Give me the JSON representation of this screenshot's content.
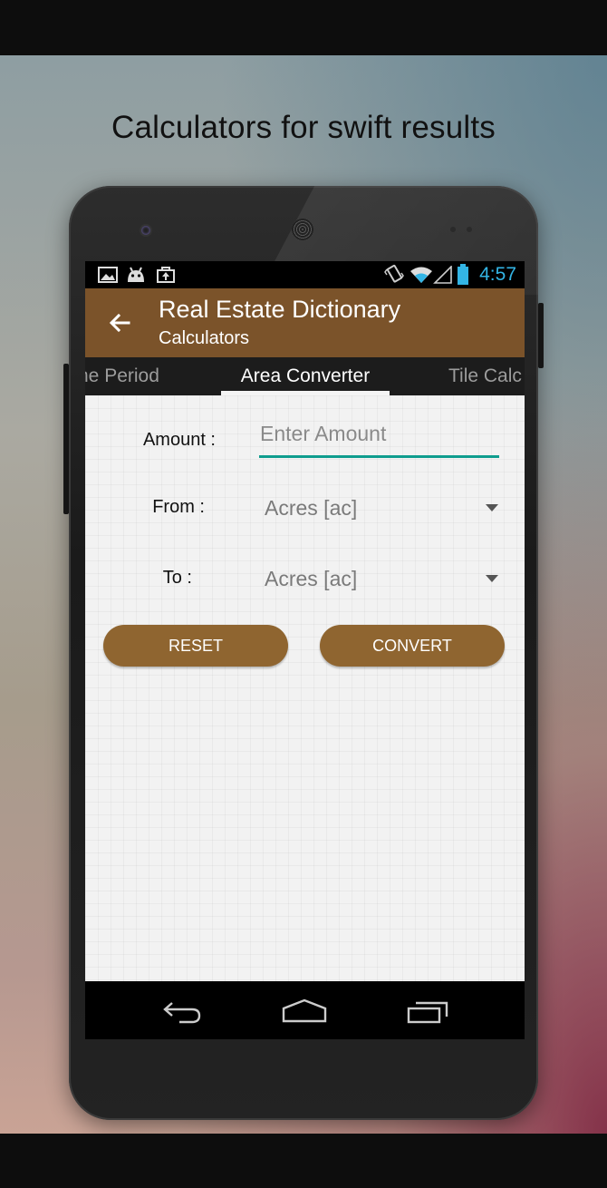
{
  "promo": {
    "headline": "Calculators for swift results"
  },
  "status_bar": {
    "time": "4:57",
    "left_icons": [
      "image-icon",
      "android-icon",
      "bag-icon"
    ],
    "right_icons": [
      "vibrate-icon",
      "wifi-icon",
      "signal-icon",
      "battery-icon"
    ],
    "time_color": "#33b5e5"
  },
  "app_bar": {
    "title": "Real Estate Dictionary",
    "subtitle": "Calculators",
    "color": "#7b532a"
  },
  "tabs": [
    {
      "label": "ne Period",
      "selected": false
    },
    {
      "label": "Area Converter",
      "selected": true
    },
    {
      "label": "Tile Calc",
      "selected": false
    }
  ],
  "form": {
    "amount_label": "Amount :",
    "amount_placeholder": "Enter Amount",
    "amount_value": "",
    "from_label": "From :",
    "from_value": "Acres [ac]",
    "to_label": "To :",
    "to_value": "Acres [ac]",
    "accent": "#0f9d8e"
  },
  "buttons": {
    "reset": "RESET",
    "convert": "CONVERT",
    "color": "#8f6530"
  },
  "nav_bar": {
    "icons": [
      "back-icon",
      "home-icon",
      "recents-icon"
    ]
  }
}
